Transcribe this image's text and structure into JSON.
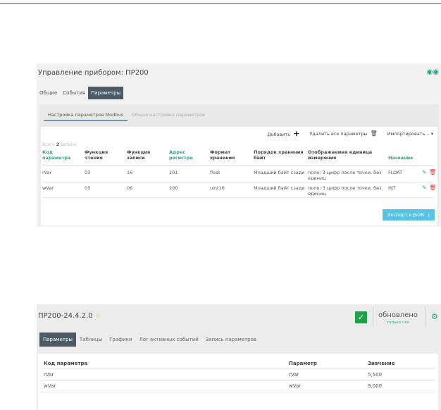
{
  "device_panel": {
    "title": "Управление прибором: ПР200",
    "tabs": [
      {
        "label": "Общие",
        "active": false
      },
      {
        "label": "События",
        "active": false
      },
      {
        "label": "Параметры",
        "active": true
      }
    ],
    "subtabs": [
      {
        "label": "Настройка параметров Modbus",
        "active": true
      },
      {
        "label": "Общая настройка параметров",
        "active": false
      }
    ],
    "toolbar": {
      "add_label": "Добавить",
      "delete_all_label": "Удалить все параметры",
      "import_label": "Импортировать..."
    },
    "total_prefix": "Всего",
    "total_count": "2",
    "total_suffix": "записи.",
    "columns": [
      "Код параметра",
      "Функция чтения",
      "Функция записи",
      "Адрес регистра",
      "Формат хранения",
      "Порядок хранения байт",
      "Отображаемая единица измерения",
      "Название"
    ],
    "rows": [
      {
        "code": "rVar",
        "read_fn": "03",
        "write_fn": "16",
        "address": "201",
        "format": "float",
        "byte_order": "Младший байт сзади",
        "unit": "поле: 3 цифр после точки, без единиц",
        "name": "FLOAT"
      },
      {
        "code": "wVar",
        "read_fn": "03",
        "write_fn": "06",
        "address": "200",
        "format": "uint16",
        "byte_order": "Младший байт сзади",
        "unit": "поле: 3 цифр после точки, без единиц",
        "name": "INT"
      }
    ],
    "export_label": "Экспорт в JSON"
  },
  "monitor_panel": {
    "title": "ПР200-24.4.2.0",
    "status": "обновлено",
    "status_sub": "только что",
    "tabs": [
      {
        "label": "Параметры",
        "active": true
      },
      {
        "label": "Таблицы",
        "active": false
      },
      {
        "label": "Графики",
        "active": false
      },
      {
        "label": "Лог активных событий",
        "active": false
      },
      {
        "label": "Запись параметров",
        "active": false
      }
    ],
    "columns": [
      "Код параметра",
      "Параметр",
      "Значение"
    ],
    "rows": [
      {
        "code": "rVar",
        "param": "rVar",
        "value": "5,500"
      },
      {
        "code": "wVar",
        "param": "wVar",
        "value": "9,000"
      }
    ]
  },
  "colors": {
    "accent": "#2ea38f",
    "tab_active": "#4c5a66",
    "export_button": "#58c4e4",
    "delete": "#e2362d",
    "ok": "#20a047"
  }
}
